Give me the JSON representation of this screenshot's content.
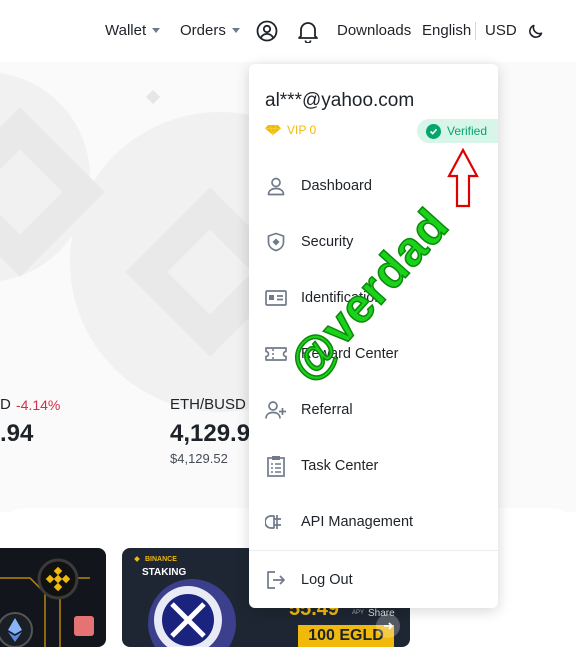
{
  "nav": {
    "wallet": "Wallet",
    "orders": "Orders",
    "downloads": "Downloads",
    "language": "English",
    "currency": "USD"
  },
  "tickers": [
    {
      "pair_fragment": "D",
      "change": "-4.14%",
      "price_fragment": ".94"
    },
    {
      "pair": "ETH/BUSD",
      "price": "4,129.9",
      "sub_price": "$4,129.52"
    }
  ],
  "cards": {
    "staking_brand": "BINANCE",
    "staking_title": "STAKING",
    "apy_value": "55.49",
    "apy_unit": "APY",
    "share": "Share",
    "promo": "100 EGLD"
  },
  "account": {
    "email": "al***@yahoo.com",
    "vip_label": "VIP 0",
    "verified_label": "Verified"
  },
  "menu": [
    {
      "label": "Dashboard",
      "icon": "user-icon"
    },
    {
      "label": "Security",
      "icon": "shield-icon"
    },
    {
      "label": "Identification",
      "icon": "id-card-icon"
    },
    {
      "label": "Reward Center",
      "icon": "ticket-icon"
    },
    {
      "label": "Referral",
      "icon": "add-user-icon"
    },
    {
      "label": "Task Center",
      "icon": "clipboard-icon"
    },
    {
      "label": "API Management",
      "icon": "plug-icon"
    },
    {
      "label": "Log Out",
      "icon": "logout-icon"
    }
  ],
  "annotation": {
    "watermark": "@verdad"
  },
  "colors": {
    "negative": "#cf304a",
    "positive": "#03a66d",
    "brand": "#f0b90b",
    "annotation_arrow": "#e00000",
    "watermark": "#19d219"
  }
}
